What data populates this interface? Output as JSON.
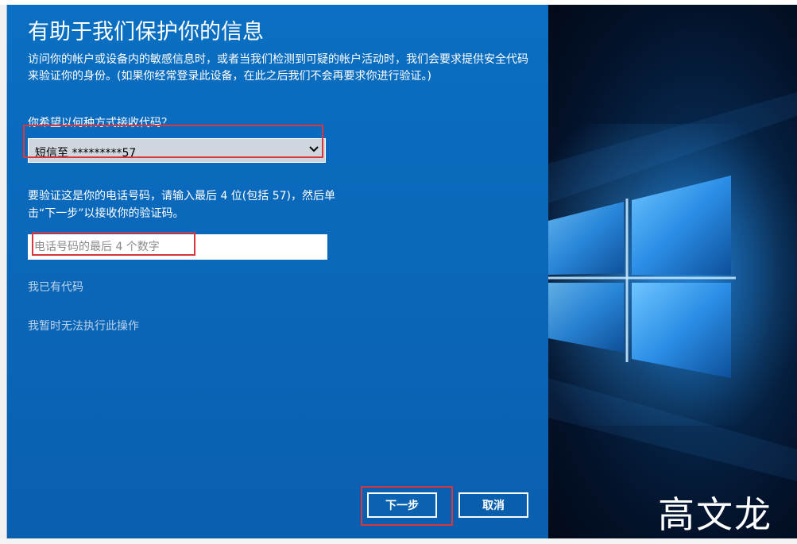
{
  "dialog": {
    "title": "有助于我们保护你的信息",
    "description": "访问你的帐户或设备内的敏感信息时，或者当我们检测到可疑的帐户活动时，我们会要求提供安全代码来验证你的身份。(如果你经常登录此设备，在此之后我们不会再要求你进行验证。)",
    "method_label": "你希望以何种方式接收代码？",
    "method_selected": "短信至 *********57",
    "verify_instructions": "要验证这是你的电话号码，请输入最后 4 位(包括 57)，然后单击“下一步”以接收你的验证码。",
    "digits_placeholder": "电话号码的最后 4 个数字",
    "digits_value": "",
    "have_code_link": "我已有代码",
    "cannot_do_link": "我暂时无法执行此操作",
    "next_button": "下一步",
    "cancel_button": "取消"
  },
  "watermark": "高文龙",
  "colors": {
    "dialog_blue": "#0a6fc2",
    "highlight_red": "#d9363e",
    "link_color": "#bcd3ec",
    "dropdown_bg": "#cfd6de"
  },
  "icons": {
    "dropdown": "chevron-down-icon",
    "hero": "windows-logo"
  }
}
